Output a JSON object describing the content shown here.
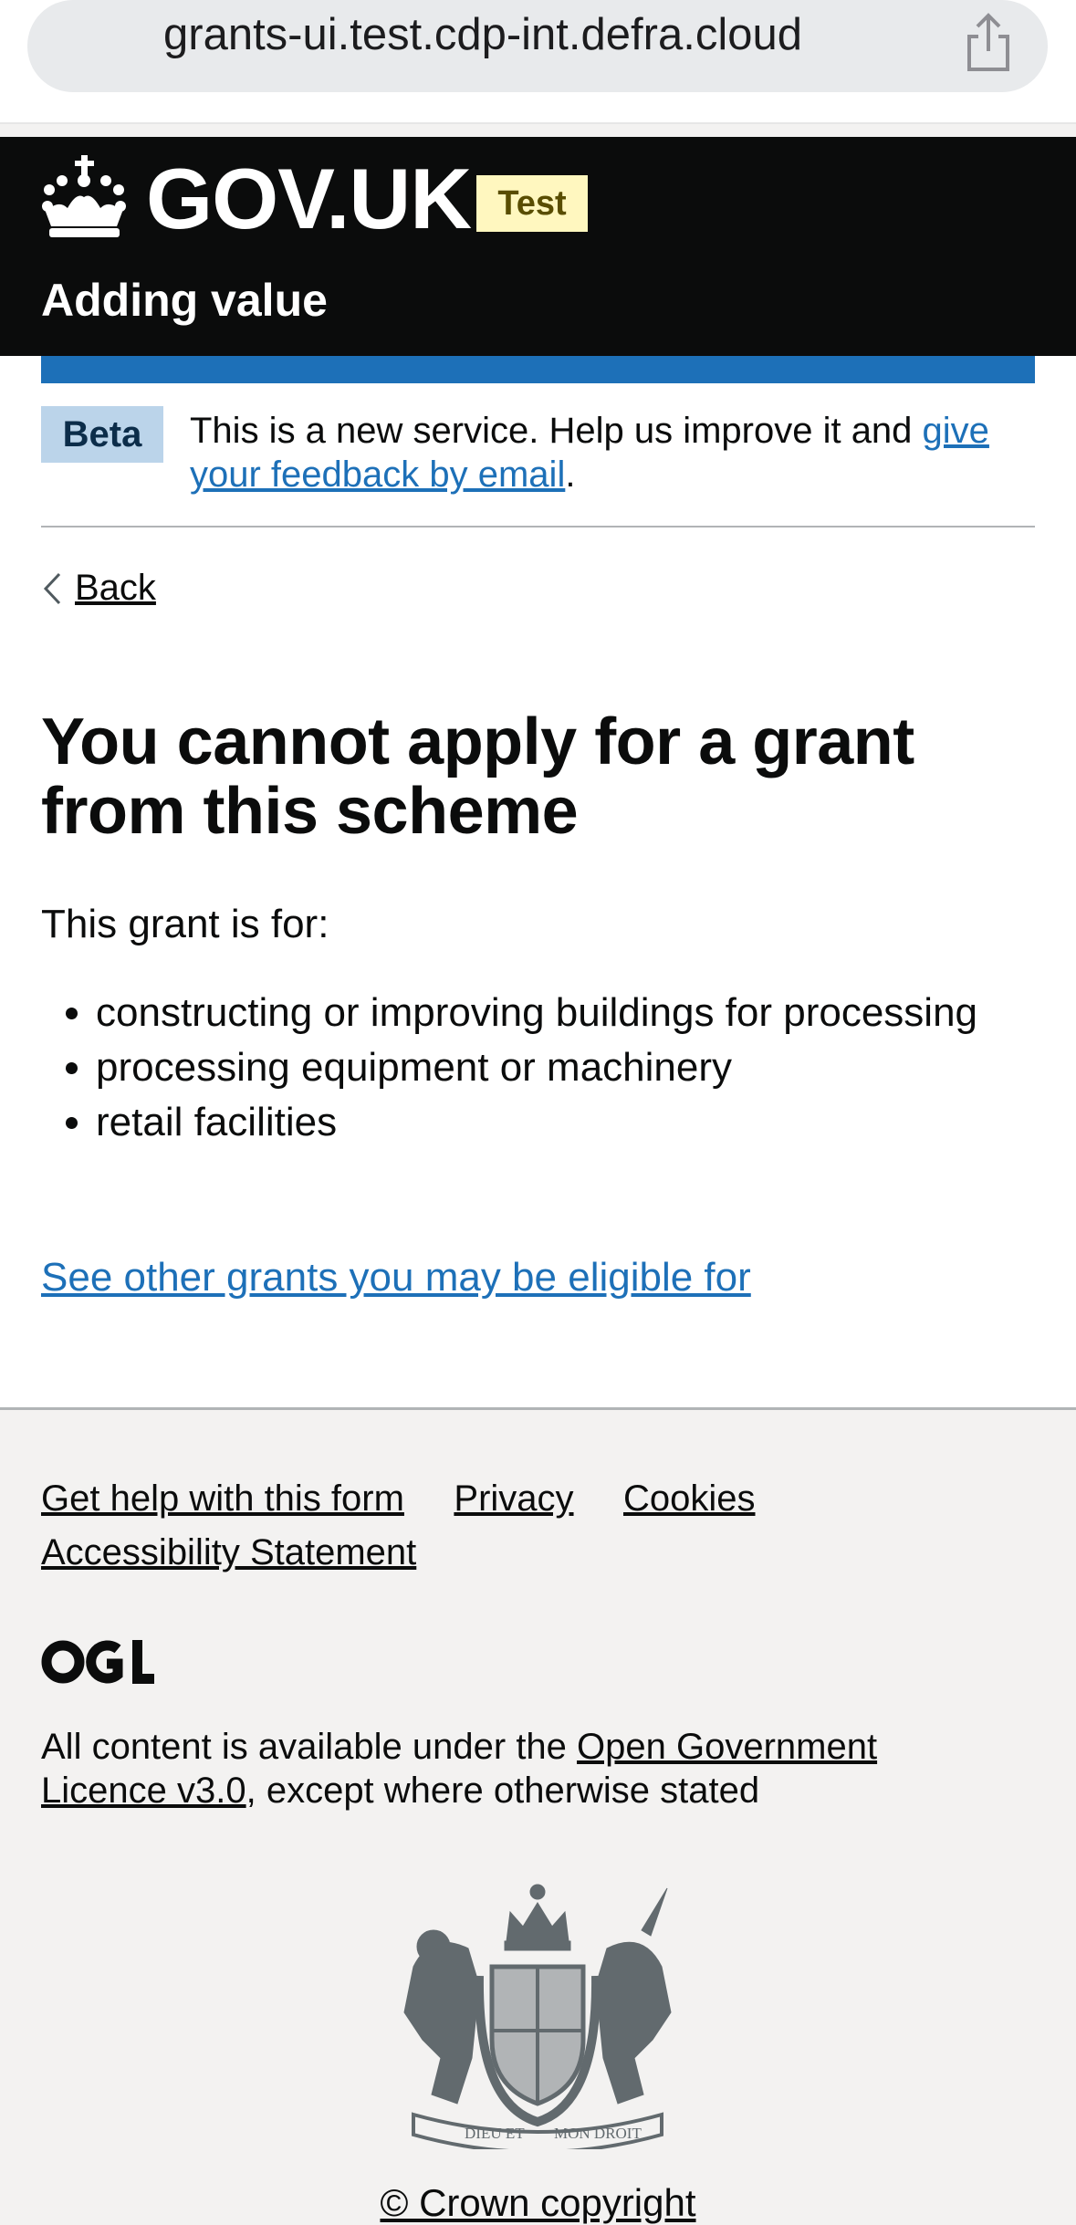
{
  "browser": {
    "url": "grants-ui.test.cdp-int.defra.cloud"
  },
  "header": {
    "logo_text": "GOV.UK",
    "env_tag": "Test",
    "service_name": "Adding value"
  },
  "phase_banner": {
    "tag": "Beta",
    "text_before": "This is a new service. Help us improve it and ",
    "link_text": "give your feedback by email",
    "text_after": "."
  },
  "back_link": "Back",
  "main": {
    "heading": "You cannot apply for a grant from this scheme",
    "intro": "This grant is for:",
    "items": [
      "constructing or improving buildings for processing",
      "processing equipment or machinery",
      "retail facilities"
    ],
    "link": "See other grants you may be eligible for"
  },
  "footer": {
    "links": [
      "Get help with this form",
      "Privacy",
      "Cookies",
      "Accessibility Statement"
    ],
    "licence_before": "All content is available under the ",
    "licence_link": "Open Government Licence v3.0",
    "licence_after": ", except where otherwise stated",
    "crest_text_left": "DIEU ET",
    "crest_text_right": "MON DROIT",
    "copyright": "© Crown copyright"
  },
  "colors": {
    "header_bg": "#0b0c0c",
    "link": "#1d70b8",
    "brand_bar": "#1d70b8",
    "footer_bg": "#f3f2f1",
    "env_tag_bg": "#fff7bf",
    "beta_tag_bg": "#bbd4ea"
  },
  "icons": {
    "share": "share-icon",
    "crown": "crown-icon",
    "back": "chevron-left-icon",
    "ogl": "ogl-logo-icon",
    "crest": "royal-coat-of-arms-icon"
  }
}
